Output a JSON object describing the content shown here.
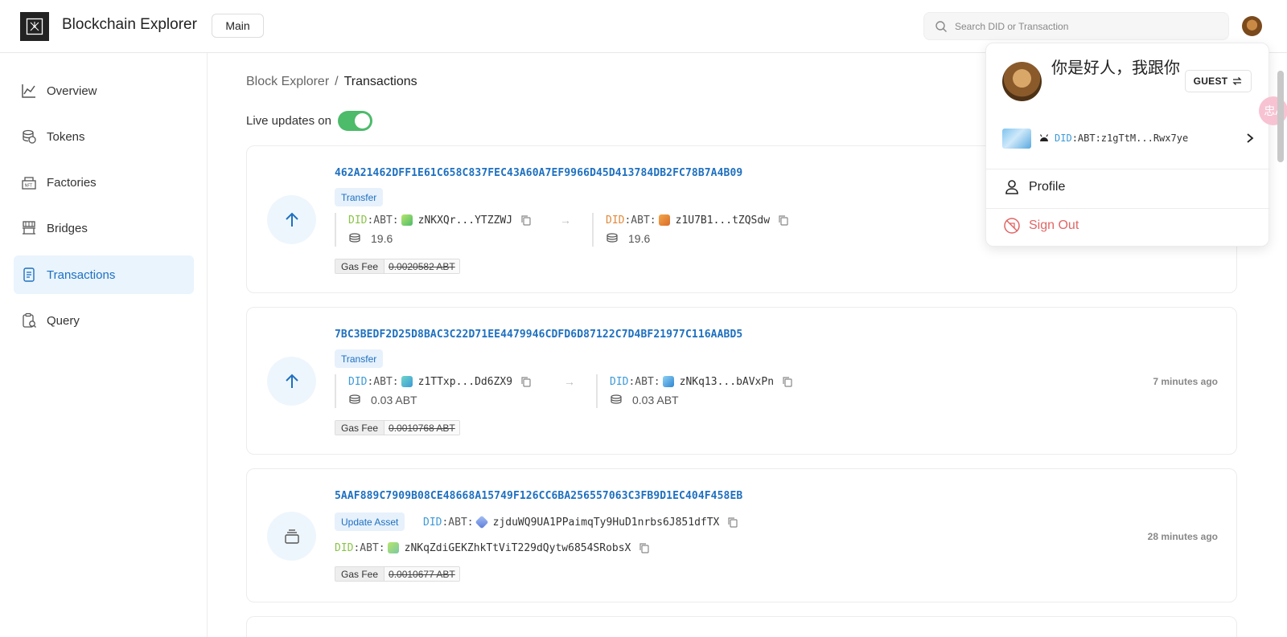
{
  "header": {
    "app_title": "Blockchain Explorer",
    "chain_label": "Main",
    "search_placeholder": "Search DID or Transaction"
  },
  "sidebar": {
    "items": [
      {
        "label": "Overview",
        "icon": "chart-line-icon",
        "active": false
      },
      {
        "label": "Tokens",
        "icon": "coins-icon",
        "active": false
      },
      {
        "label": "Factories",
        "icon": "factory-icon",
        "active": false
      },
      {
        "label": "Bridges",
        "icon": "bridge-icon",
        "active": false
      },
      {
        "label": "Transactions",
        "icon": "document-list-icon",
        "active": true
      },
      {
        "label": "Query",
        "icon": "clipboard-query-icon",
        "active": false
      }
    ]
  },
  "breadcrumb": {
    "root": "Block Explorer",
    "separator": "/",
    "current": "Transactions"
  },
  "live_updates": {
    "label": "Live updates on",
    "enabled": true
  },
  "transactions": [
    {
      "hash": "462A21462DFF1E61C658C837FEC43A60A7EF9966D45D413784DB2FC78B7A4B09",
      "type": "Transfer",
      "from": {
        "did_prefix": "DID",
        "did_chain": ":ABT:",
        "address": "zNKXQr...YTZZWJ",
        "amount": "19.6"
      },
      "to": {
        "did_prefix": "DID",
        "did_chain": ":ABT:",
        "address": "z1U7B1...tZQSdw",
        "amount": "19.6"
      },
      "gas_label": "Gas Fee",
      "gas_value": "0.0020582 ABT",
      "time": ""
    },
    {
      "hash": "7BC3BEDF2D25D8BAC3C22D71EE4479946CDFD6D87122C7D4BF21977C116AABD5",
      "type": "Transfer",
      "from": {
        "did_prefix": "DID",
        "did_chain": ":ABT:",
        "address": "z1TTxp...Dd6ZX9",
        "amount": "0.03 ABT"
      },
      "to": {
        "did_prefix": "DID",
        "did_chain": ":ABT:",
        "address": "zNKq13...bAVxPn",
        "amount": "0.03 ABT"
      },
      "gas_label": "Gas Fee",
      "gas_value": "0.0010768 ABT",
      "time": "7 minutes ago"
    },
    {
      "hash": "5AAF889C7909B08CE48668A15749F126CC6BA256557063C3FB9D1EC404F458EB",
      "type": "Update Asset",
      "asset": {
        "did_prefix": "DID",
        "did_chain": ":ABT:",
        "address": "zjduWQ9UA1PPaimqTy9HuD1nrbs6J851dfTX"
      },
      "owner": {
        "did_prefix": "DID",
        "did_chain": ":ABT:",
        "address": "zNKqZdiGEKZhkTtViT229dQytw6854SRobsX"
      },
      "gas_label": "Gas Fee",
      "gas_value": "0.0010677 ABT",
      "time": "28 minutes ago"
    }
  ],
  "user_menu": {
    "name": "你是好人，我跟你",
    "role_button": "GUEST",
    "did_prefix": "DID",
    "did_rest": ":ABT:z1gTtM...Rwx7ye",
    "profile_label": "Profile",
    "signout_label": "Sign Out"
  },
  "translate_bubble": "忠A",
  "colors": {
    "accent": "#1e70c0",
    "accent_bg": "#e9f4fd",
    "toggle_on": "#4cbb6a",
    "signout": "#e06666"
  }
}
